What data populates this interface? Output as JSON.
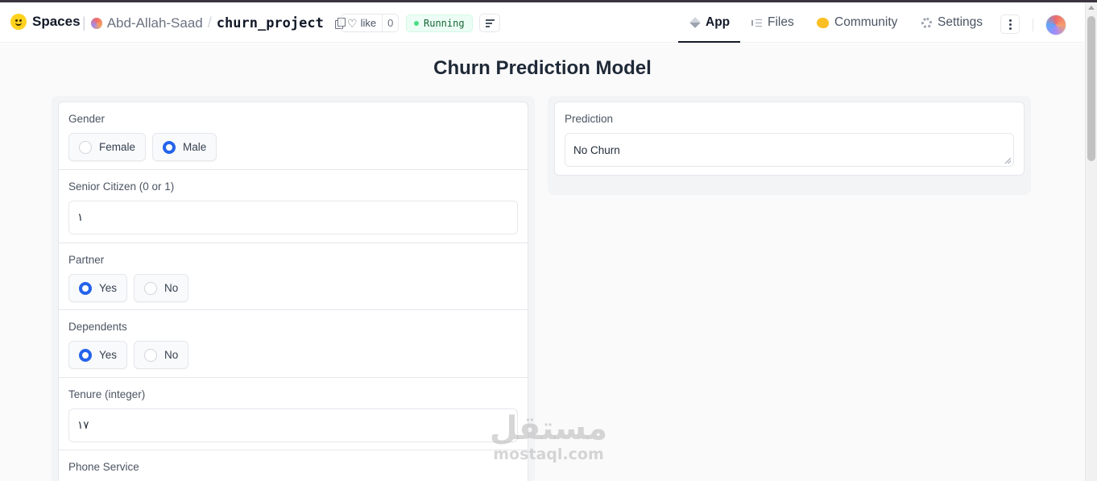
{
  "header": {
    "brand": "Spaces",
    "owner": "Abd-Allah-Saad",
    "separator": "/",
    "repo": "churn_project",
    "like_label": "like",
    "like_count": "0",
    "status": "Running",
    "nav": [
      {
        "label": "App",
        "icon": "cube-icon",
        "active": true
      },
      {
        "label": "Files",
        "icon": "files-icon",
        "active": false
      },
      {
        "label": "Community",
        "icon": "community-icon",
        "active": false
      },
      {
        "label": "Settings",
        "icon": "gear-icon",
        "active": false
      }
    ]
  },
  "app": {
    "title": "Churn Prediction Model",
    "form": {
      "gender": {
        "label": "Gender",
        "options": [
          "Female",
          "Male"
        ],
        "selected": "Male"
      },
      "senior": {
        "label": "Senior Citizen (0 or 1)",
        "value": "١"
      },
      "partner": {
        "label": "Partner",
        "options": [
          "Yes",
          "No"
        ],
        "selected": "Yes"
      },
      "dependents": {
        "label": "Dependents",
        "options": [
          "Yes",
          "No"
        ],
        "selected": "Yes"
      },
      "tenure": {
        "label": "Tenure (integer)",
        "value": "١٧"
      },
      "phone": {
        "label": "Phone Service"
      }
    },
    "prediction": {
      "label": "Prediction",
      "value": "No Churn"
    }
  },
  "watermark": {
    "arabic": "مستقل",
    "latin": "mostaql.com"
  },
  "colors": {
    "accent": "#2563eb",
    "running_bg": "#ecfdf5",
    "running_dot": "#4ade80"
  }
}
